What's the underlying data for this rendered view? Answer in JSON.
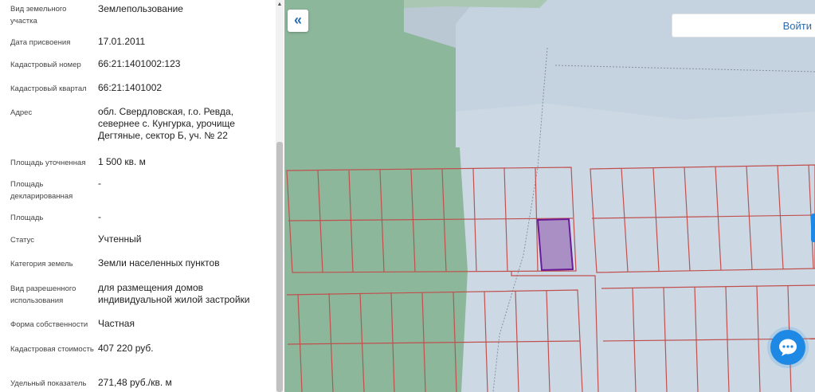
{
  "info": {
    "rows": [
      {
        "label": "Вид земельного участка",
        "value": "Землепользование"
      },
      {
        "label": "Дата присвоения",
        "value": "17.01.2011"
      },
      {
        "label": "Кадастровый номер",
        "value": "66:21:1401002:123"
      },
      {
        "label": "Кадастровый квартал",
        "value": "66:21:1401002"
      },
      {
        "label": "Адрес",
        "value": "обл. Свердловская, г.о. Ревда, севернее с. Кунгурка, урочище Дегтяные, сектор Б, уч. № 22"
      },
      {
        "label": "Площадь уточненная",
        "value": "1 500 кв. м"
      },
      {
        "label": "Площадь декларированная",
        "value": "-"
      },
      {
        "label": "Площадь",
        "value": "-"
      },
      {
        "label": "Статус",
        "value": "Учтенный"
      },
      {
        "label": "Категория земель",
        "value": "Земли населенных пунктов"
      },
      {
        "label": "Вид разрешенного использования",
        "value": "для размещения домов индивидуальной жилой застройки"
      },
      {
        "label": "Форма собственности",
        "value": "Частная"
      },
      {
        "label": "Кадастровая стоимость",
        "value": "407 220 руб."
      },
      {
        "label": "Удельный показатель",
        "value": "271,48 руб./кв. м"
      }
    ]
  },
  "map": {
    "collapse_icon": "«",
    "login_label": "Войти",
    "colors": {
      "water": "#b9c8d2",
      "light_area": "#ccd9e5",
      "forest": "#8db79b",
      "plot_border": "#c0504d",
      "selected_plot": "#a98fc4",
      "selected_border": "#6a1b9a",
      "chat": "#1e88e5"
    }
  }
}
